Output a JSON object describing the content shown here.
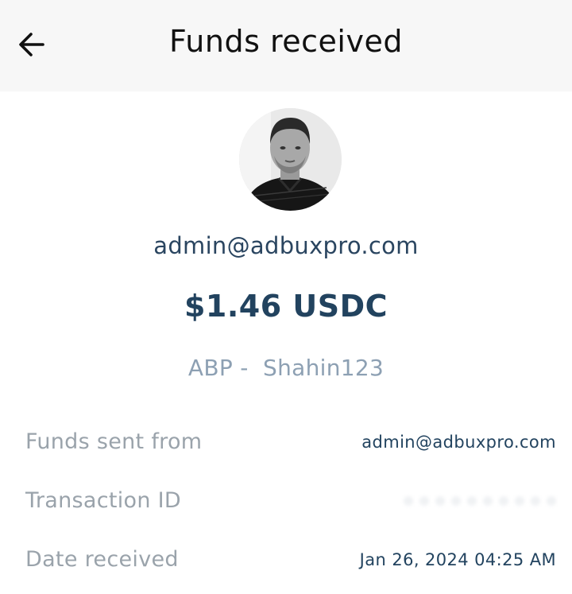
{
  "header": {
    "title": "Funds received",
    "back_icon": "arrow-left-icon"
  },
  "recipient": {
    "avatar_icon": "user-avatar-photo",
    "email": "admin@adbuxpro.com"
  },
  "amount": "$1.46 USDC",
  "memo": "ABP -  Shahin123",
  "details": {
    "sent_from": {
      "label": "Funds sent from",
      "value": "admin@adbuxpro.com"
    },
    "transaction_id": {
      "label": "Transaction ID",
      "value": ""
    },
    "date_received": {
      "label": "Date received",
      "value": "Jan 26, 2024 04:25 AM"
    }
  },
  "colors": {
    "header_bg": "#f7f7f7",
    "primary_text": "#22435f",
    "muted_text": "#9aa3ab",
    "memo_text": "#8da0b3"
  }
}
